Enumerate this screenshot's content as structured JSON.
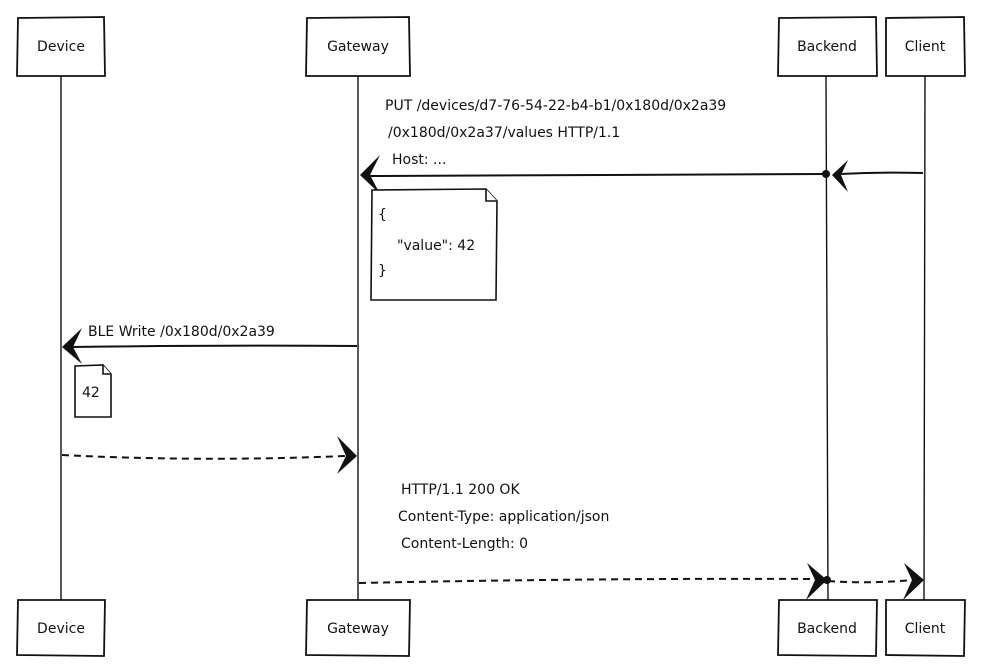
{
  "diagram": {
    "type": "sequence",
    "participants": [
      {
        "id": "device",
        "label": "Device"
      },
      {
        "id": "gateway",
        "label": "Gateway"
      },
      {
        "id": "backend",
        "label": "Backend"
      },
      {
        "id": "client",
        "label": "Client"
      }
    ],
    "messages": [
      {
        "from": "client",
        "to": "gateway",
        "via": "backend",
        "style": "solid",
        "lines": [
          "PUT /devices/d7-76-54-22-b4-b1/0x180d/0x2a39",
          "/0x180d/0x2a37/values HTTP/1.1",
          "Host: ..."
        ]
      },
      {
        "from": "gateway",
        "to": "device",
        "style": "solid",
        "lines": [
          "BLE Write /0x180d/0x2a39"
        ]
      },
      {
        "from": "device",
        "to": "gateway",
        "style": "dashed",
        "lines": []
      },
      {
        "from": "gateway",
        "to": "client",
        "via": "backend",
        "style": "dashed",
        "lines": [
          "HTTP/1.1 200 OK",
          "Content-Type: application/json",
          "Content-Length: 0"
        ]
      }
    ],
    "notes": [
      {
        "attached_to": "gateway",
        "lines": [
          "{",
          "  \"value\": 42",
          "}"
        ]
      },
      {
        "attached_to": "device",
        "lines": [
          "42"
        ]
      }
    ]
  }
}
